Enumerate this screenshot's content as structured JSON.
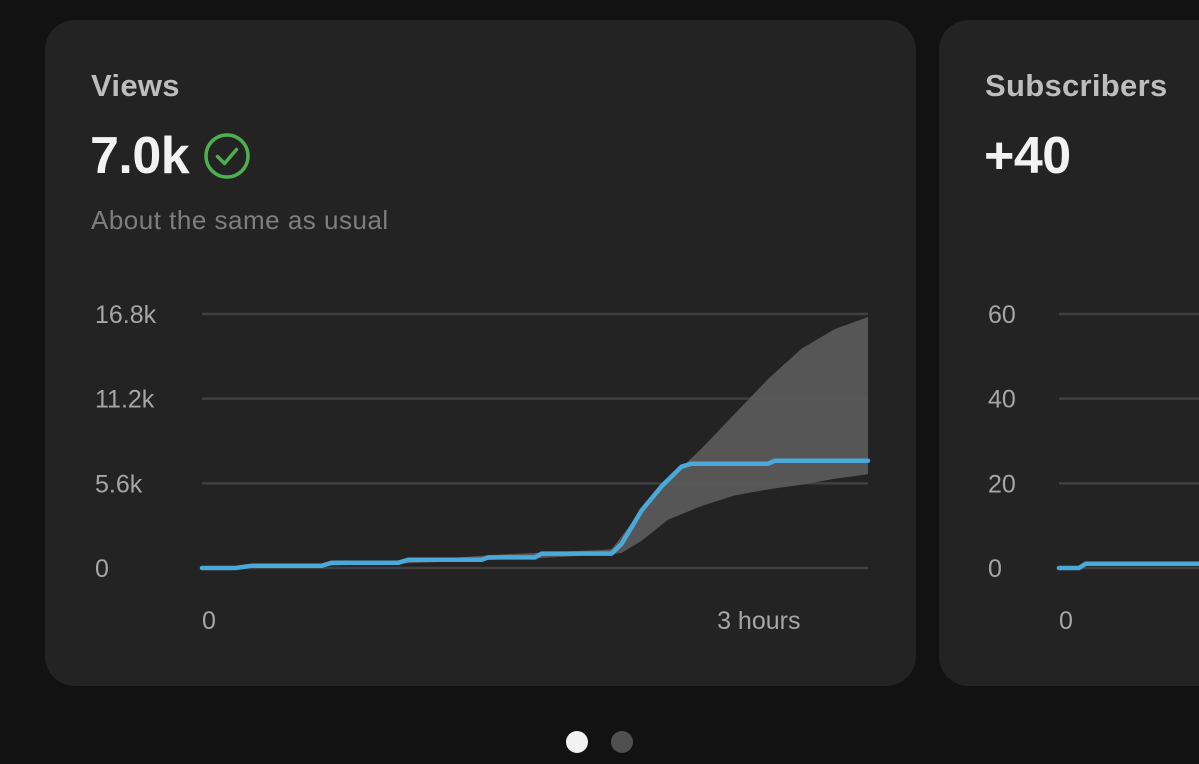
{
  "cards": {
    "views": {
      "title": "Views",
      "value": "7.0k",
      "status_icon": "check-circle-icon",
      "status_color": "#4caf50",
      "subtitle": "About the same as usual"
    },
    "subscribers": {
      "title": "Subscribers",
      "value": "+40"
    }
  },
  "pagination": {
    "pages": 2,
    "active_index": 0
  },
  "colors": {
    "line": "#4ba9d9",
    "band": "#5a5a5a",
    "grid": "#404040",
    "card_bg": "#232323",
    "page_bg": "#121212"
  },
  "chart_data": [
    {
      "type": "line",
      "ylim": [
        0,
        16.8
      ],
      "y_unit": "k",
      "y_ticks": [
        {
          "value": 16.8,
          "label": "16.8k"
        },
        {
          "value": 11.2,
          "label": "11.2k"
        },
        {
          "value": 5.6,
          "label": "5.6k"
        },
        {
          "value": 0,
          "label": "0"
        }
      ],
      "x_ticks": [
        {
          "value": 0,
          "label": "0"
        },
        {
          "value": 0.836,
          "label": "3 hours"
        }
      ],
      "xlim": [
        0,
        1
      ],
      "grid": true,
      "series": [
        {
          "role": "views",
          "points": [
            [
              0,
              0
            ],
            [
              0.05,
              0
            ],
            [
              0.075,
              0.15
            ],
            [
              0.18,
              0.15
            ],
            [
              0.195,
              0.35
            ],
            [
              0.295,
              0.35
            ],
            [
              0.31,
              0.55
            ],
            [
              0.42,
              0.55
            ],
            [
              0.43,
              0.7
            ],
            [
              0.5,
              0.7
            ],
            [
              0.51,
              0.95
            ],
            [
              0.615,
              0.95
            ],
            [
              0.63,
              1.6
            ],
            [
              0.66,
              3.8
            ],
            [
              0.69,
              5.4
            ],
            [
              0.72,
              6.7
            ],
            [
              0.735,
              6.9
            ],
            [
              0.85,
              6.9
            ],
            [
              0.86,
              7.1
            ],
            [
              1,
              7.1
            ]
          ]
        }
      ],
      "band": {
        "role": "typical-range",
        "upper": [
          [
            0,
            0
          ],
          [
            0.15,
            0.15
          ],
          [
            0.3,
            0.45
          ],
          [
            0.45,
            0.9
          ],
          [
            0.6,
            1.2
          ],
          [
            0.615,
            1.25
          ],
          [
            0.66,
            3.8
          ],
          [
            0.7,
            5.8
          ],
          [
            0.75,
            7.9
          ],
          [
            0.8,
            10.2
          ],
          [
            0.85,
            12.5
          ],
          [
            0.9,
            14.5
          ],
          [
            0.95,
            15.8
          ],
          [
            1,
            16.6
          ]
        ],
        "lower": [
          [
            1,
            6.2
          ],
          [
            0.95,
            5.9
          ],
          [
            0.9,
            5.5
          ],
          [
            0.85,
            5.2
          ],
          [
            0.8,
            4.8
          ],
          [
            0.75,
            4.1
          ],
          [
            0.7,
            3.2
          ],
          [
            0.66,
            1.8
          ],
          [
            0.63,
            1.0
          ],
          [
            0.615,
            0.9
          ],
          [
            0.5,
            0.65
          ],
          [
            0.3,
            0.3
          ],
          [
            0.15,
            0.1
          ],
          [
            0,
            0
          ]
        ]
      }
    },
    {
      "type": "line",
      "ylim": [
        0,
        60
      ],
      "y_ticks": [
        {
          "value": 60,
          "label": "60"
        },
        {
          "value": 40,
          "label": "40"
        },
        {
          "value": 20,
          "label": "20"
        },
        {
          "value": 0,
          "label": "0"
        }
      ],
      "x_ticks": [
        {
          "value": 0,
          "label": "0"
        }
      ],
      "xlim": [
        0,
        1
      ],
      "grid": true,
      "series": [
        {
          "role": "subscribers",
          "points": [
            [
              0,
              0
            ],
            [
              0.03,
              0
            ],
            [
              0.04,
              1
            ],
            [
              1,
              1
            ]
          ]
        }
      ]
    }
  ]
}
